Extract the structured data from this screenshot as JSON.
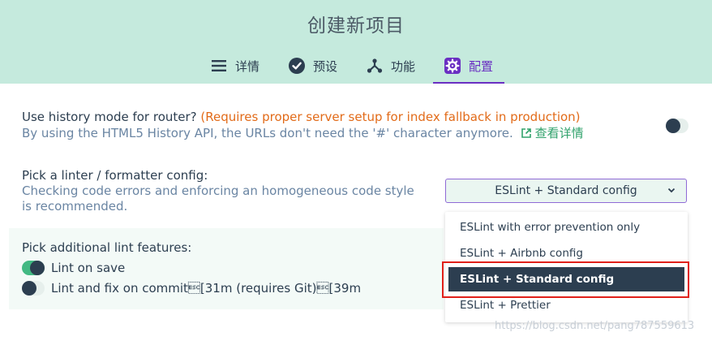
{
  "header": {
    "title": "创建新项目"
  },
  "tabs": [
    {
      "label": "详情",
      "icon": "list-icon"
    },
    {
      "label": "预设",
      "icon": "check-circle-icon"
    },
    {
      "label": "功能",
      "icon": "branch-icon"
    },
    {
      "label": "配置",
      "icon": "gear-icon"
    }
  ],
  "active_tab": "配置",
  "router": {
    "label": "Use history mode for router?",
    "warning": "(Requires proper server setup for index fallback in production)",
    "desc": "By using the HTML5 History API, the URLs don't need the '#' character anymore.",
    "link_label": "查看详情",
    "toggle": false
  },
  "linter": {
    "label": "Pick a linter / formatter config:",
    "desc": "Checking code errors and enforcing an homogeneous code style is recommended.",
    "selected": "ESLint + Standard config",
    "options": [
      "ESLint with error prevention only",
      "ESLint + Airbnb config",
      "ESLint + Standard config",
      "ESLint + Prettier"
    ]
  },
  "lint_features": {
    "label": "Pick additional lint features:",
    "items": [
      {
        "label": "Lint on save",
        "on": true
      },
      {
        "label": "Lint and fix on commit\u001b[31m (requires Git)\u001b[39m",
        "on": false
      }
    ]
  },
  "colors": {
    "accent": "#42b983",
    "purple": "#6a2fc2",
    "header_bg": "#c5eadd",
    "warning": "#e26b19"
  },
  "watermark": "https://blog.csdn.net/pang787559613"
}
